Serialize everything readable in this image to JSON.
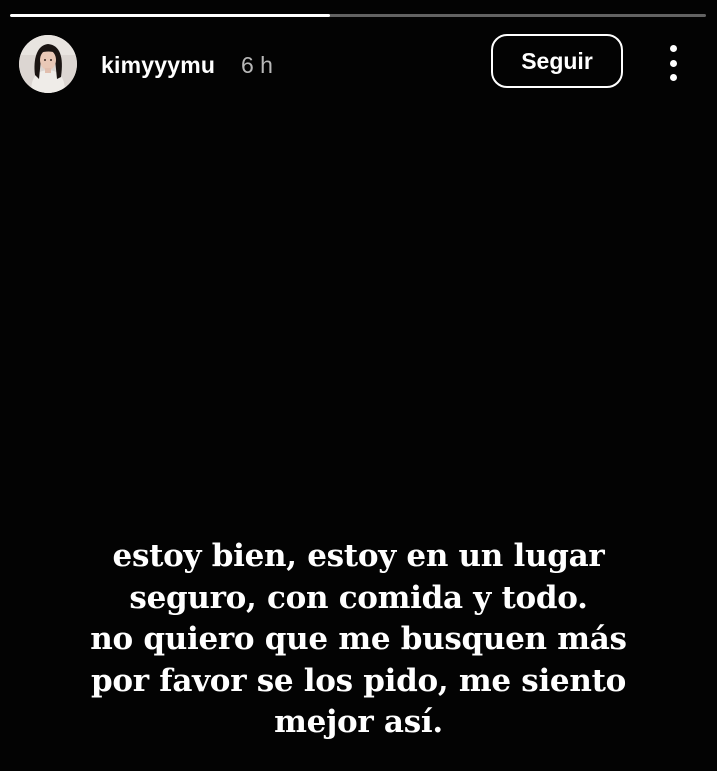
{
  "story": {
    "progress": 0.46,
    "text_lines": [
      "estoy bien, estoy en un lugar",
      "seguro, con comida y todo.",
      " no quiero que me busquen más",
      "por favor se los pido, me siento",
      "mejor así."
    ]
  },
  "header": {
    "username": "kimyyymu",
    "time": "6 h",
    "follow_label": "Seguir",
    "avatar_icon": "profile-photo",
    "more_icon": "more-vertical-icon"
  },
  "colors": {
    "background": "#030303",
    "text": "#ffffff",
    "time": "#b8b8b8",
    "progress_track": "rgba(255,255,255,0.38)"
  }
}
